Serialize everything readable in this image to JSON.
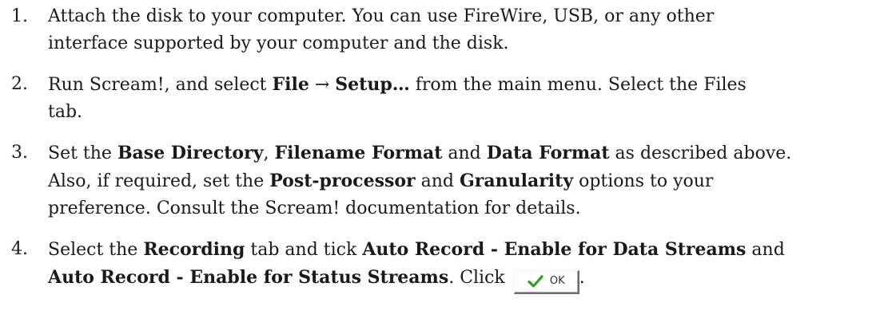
{
  "steps": [
    {
      "number": "1.",
      "line1": "Attach the disk to your computer.  You can use FireWire, USB, or any other",
      "line2": "interface supported by your computer and the disk."
    },
    {
      "number": "2.",
      "line1_a": "Run Scream!, and select ",
      "line1_b": "File",
      "line1_c": " → ",
      "line1_d": "Setup…",
      "line1_e": " from the main menu.  Select the Files",
      "line2": "tab."
    },
    {
      "number": "3.",
      "line1_a": "Set the ",
      "line1_b": "Base Directory",
      "line1_c": ", ",
      "line1_d": "Filename Format",
      "line1_e": " and ",
      "line1_f": "Data Format",
      "line1_g": " as described above.",
      "line2_a": "Also, if required, set the ",
      "line2_b": "Post-processor",
      "line2_c": " and ",
      "line2_d": "Granularity",
      "line2_e": " options to your",
      "line3": "preference.  Consult the Scream! documentation for details."
    },
    {
      "number": "4.",
      "line1_a": "Select the ",
      "line1_b": "Recording",
      "line1_c": " tab and tick ",
      "line1_d": "Auto Record - Enable for Data Streams",
      "line1_e": " and",
      "line2_a": "Auto Record - Enable for Status Streams",
      "line2_b": ".  Click ",
      "ok_button_label": "OK",
      "line2_end": "."
    }
  ],
  "icons": {
    "ok_check": "checkmark-icon",
    "check_color": "#2e9e1f"
  }
}
